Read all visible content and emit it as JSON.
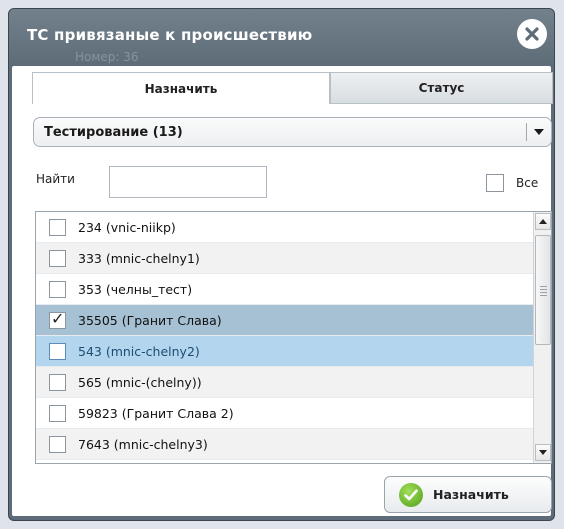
{
  "dialog": {
    "title": "ТС привязаные к происшествию",
    "background_text": "Номер:   36",
    "close_icon": "close-icon"
  },
  "tabs": [
    {
      "label": "Назначить",
      "active": true
    },
    {
      "label": "Статус",
      "active": false
    }
  ],
  "group_select": {
    "value": "Тестирование (13)"
  },
  "search": {
    "label": "Найти",
    "value": ""
  },
  "select_all": {
    "label": "Все",
    "checked": false
  },
  "vehicles": [
    {
      "label": "234 (vnic-niikp)",
      "checked": false,
      "state": "normal"
    },
    {
      "label": "333 (mnic-chelny1)",
      "checked": false,
      "state": "alt"
    },
    {
      "label": "353 (челны_тест)",
      "checked": false,
      "state": "normal"
    },
    {
      "label": "35505 (Гранит Слава)",
      "checked": true,
      "state": "selected"
    },
    {
      "label": "543 (mnic-chelny2)",
      "checked": false,
      "state": "hover"
    },
    {
      "label": "565 (mnic-(chelny))",
      "checked": false,
      "state": "alt"
    },
    {
      "label": "59823 (Гранит Слава 2)",
      "checked": false,
      "state": "normal"
    },
    {
      "label": "7643 (mnic-chelny3)",
      "checked": false,
      "state": "alt"
    }
  ],
  "footer": {
    "assign_label": "Назначить"
  },
  "colors": {
    "titlebar": "#5f6d79",
    "selected_row": "#a6c0d4",
    "hover_row": "#b3d6ee",
    "ok_icon": "#4f9f1a"
  }
}
